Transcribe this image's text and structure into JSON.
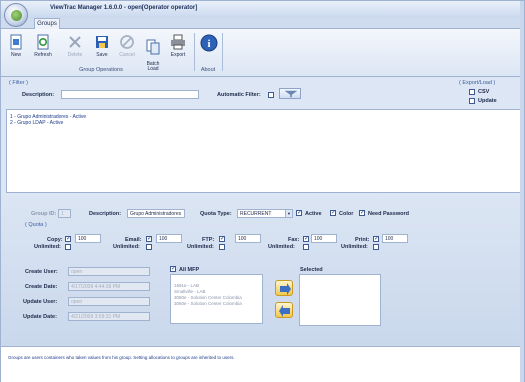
{
  "window": {
    "title": "ViewTrac Manager 1.6.0.0 - open[Operator operator]"
  },
  "tabs": [
    {
      "label": "Groups"
    }
  ],
  "ribbon": {
    "group_operations": {
      "label": "Group Operations",
      "buttons": [
        {
          "label": "New",
          "icon": "new-doc-icon",
          "enabled": true
        },
        {
          "label": "Refresh",
          "icon": "refresh-icon",
          "enabled": true
        },
        {
          "label": "Delete",
          "icon": "delete-x-icon",
          "enabled": false
        },
        {
          "label": "Save",
          "icon": "save-disk-icon",
          "enabled": true
        },
        {
          "label": "Cancel",
          "icon": "cancel-icon",
          "enabled": false
        },
        {
          "label": "Batch\nLoad",
          "icon": "batch-load-icon",
          "enabled": true
        },
        {
          "label": "Export",
          "icon": "export-printer-icon",
          "enabled": true
        }
      ]
    },
    "about": {
      "label": "About",
      "icon": "info-icon"
    }
  },
  "filter": {
    "header": "( Filter )",
    "description_label": "Description:",
    "description_value": "",
    "automatic_filter_label": "Automatic Filter:",
    "automatic_filter_checked": false
  },
  "export_load": {
    "header": "( Export/Load )",
    "csv_label": "CSV",
    "csv_checked": false,
    "update_label": "Update",
    "update_checked": false
  },
  "groups_list": [
    "1 - Grupo Administradores - Active",
    "2 - Grupo LDAP - Active"
  ],
  "detail": {
    "group_id_label": "Group ID:",
    "group_id_value": "1",
    "description_label": "Description:",
    "description_value": "Grupo Administradores",
    "quota_type_label": "Quota Type:",
    "quota_type_value": "RECURRENT",
    "active_label": "Active",
    "active_checked": true,
    "color_label": "Color",
    "color_checked": true,
    "need_password_label": "Need Password",
    "need_password_checked": true,
    "quota_header": "( Quota )",
    "quotas": [
      {
        "label": "Copy:",
        "checked": true,
        "value": "100",
        "unlimited_label": "Unlimited:"
      },
      {
        "label": "Email:",
        "checked": true,
        "value": "100",
        "unlimited_label": "Unlimited:"
      },
      {
        "label": "FTP:",
        "checked": true,
        "value": "100",
        "unlimited_label": "Unlimited:"
      },
      {
        "label": "Fax:",
        "checked": true,
        "value": "100",
        "unlimited_label": "Unlimited:"
      },
      {
        "label": "Print:",
        "checked": true,
        "value": "100",
        "unlimited_label": "Unlimited:"
      }
    ],
    "create_user_label": "Create User:",
    "create_user_value": "open",
    "create_date_label": "Create Date:",
    "create_date_value": "4/17/2009 4:44:39 PM",
    "update_user_label": "Update User:",
    "update_user_value": "open",
    "update_date_label": "Update Date:",
    "update_date_value": "4/21/2009 3:59:31 PM",
    "all_mfp_label": "All MFP",
    "all_mfp_checked": true,
    "mfp_items": [
      "1691e - LAB",
      "Smallville - LAB",
      "3060e - Solution Center Colombia",
      "3060e - Solution Center Colombia"
    ],
    "selected_label": "Selected"
  },
  "status_text": "Groups are users containers who taken values from his group. Setting allocations to groups are inherited to users."
}
